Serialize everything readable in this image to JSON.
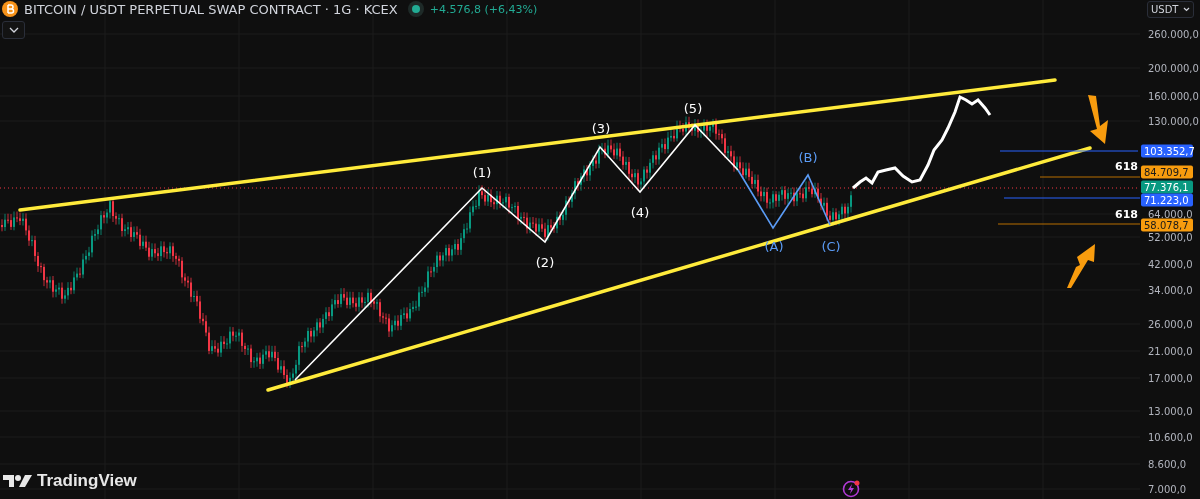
{
  "header": {
    "title": "BITCOIN / USDT PERPETUAL SWAP CONTRACT · 1G · KCEX",
    "change": "+4.576,8 (+6,43%)"
  },
  "currency": "USDT",
  "price_axis": [
    "260.000,0",
    "200.000,0",
    "160.000,0",
    "130.000,0",
    "64.000,0",
    "52.000,0",
    "42.000,0",
    "34.000,0",
    "26.000,0",
    "21.000,0",
    "17.000,0",
    "13.000,0",
    "10.600,0",
    "8.600,0",
    "7.000,0"
  ],
  "wave_labels": [
    {
      "text": "(1)",
      "kind": "impulse"
    },
    {
      "text": "(2)",
      "kind": "impulse"
    },
    {
      "text": "(3)",
      "kind": "impulse"
    },
    {
      "text": "(4)",
      "kind": "impulse"
    },
    {
      "text": "(5)",
      "kind": "impulse"
    },
    {
      "text": "(A)",
      "kind": "corrective"
    },
    {
      "text": "(B)",
      "kind": "corrective"
    },
    {
      "text": "(C)",
      "kind": "corrective"
    }
  ],
  "fib_labels": [
    "618",
    "618"
  ],
  "price_tags": [
    {
      "text": "103.352,7",
      "color": "#2962ff"
    },
    {
      "text": "84.709,7",
      "color": "#f89c0e"
    },
    {
      "text": "77.376,1",
      "color": "#089981"
    },
    {
      "text": "71.223,0",
      "color": "#2962ff"
    },
    {
      "text": "58.078,7",
      "color": "#f89c0e"
    }
  ],
  "brand": "TradingView"
}
